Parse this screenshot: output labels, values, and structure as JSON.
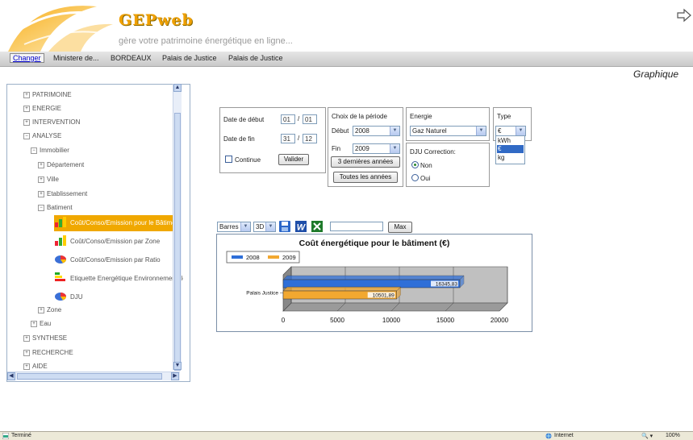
{
  "header": {
    "brand": "GEPweb",
    "tagline": "gère votre patrimoine énergétique en ligne..."
  },
  "nav": {
    "change": "Changer",
    "items": [
      "Ministere de...",
      "BORDEAUX",
      "Palais de Justice",
      "Palais de Justice"
    ]
  },
  "page_title": "Graphique",
  "sidebar": {
    "items": [
      {
        "label": "PATRIMOINE",
        "expand": "+"
      },
      {
        "label": "ENERGIE",
        "expand": "+"
      },
      {
        "label": "INTERVENTION",
        "expand": "+"
      },
      {
        "label": "ANALYSE",
        "expand": "−"
      },
      {
        "label": "Immobilier",
        "expand": "−"
      },
      {
        "label": "Département",
        "expand": "+"
      },
      {
        "label": "Ville",
        "expand": "+"
      },
      {
        "label": "Etablissement",
        "expand": "+"
      },
      {
        "label": "Batiment",
        "expand": "−"
      },
      {
        "label": "Coût/Conso/Emission pour le Bâtiment"
      },
      {
        "label": "Coût/Conso/Emission par Zone"
      },
      {
        "label": "Coût/Conso/Emission par Ratio"
      },
      {
        "label": "Etiquette Energétique Environnementale"
      },
      {
        "label": "DJU"
      },
      {
        "label": "Zone",
        "expand": "+"
      },
      {
        "label": "Eau",
        "expand": "+"
      },
      {
        "label": "SYNTHESE",
        "expand": "+"
      },
      {
        "label": "RECHERCHE",
        "expand": "+"
      },
      {
        "label": "AIDE",
        "expand": "+"
      }
    ]
  },
  "dates": {
    "start_label": "Date de début",
    "start_day": "01",
    "start_month": "01",
    "end_label": "Date de fin",
    "end_day": "31",
    "end_month": "12",
    "sep": "/",
    "continue_label": "Continue",
    "validate": "Valider"
  },
  "period": {
    "title": "Choix de la période",
    "start_label": "Début",
    "start_value": "2008",
    "end_label": "Fin",
    "end_value": "2009",
    "last3": "3 dernières années",
    "all": "Toutes les années"
  },
  "energy": {
    "title": "Energie",
    "value": "Gaz Naturel"
  },
  "dju": {
    "title": "DJU Correction:",
    "no": "Non",
    "yes": "Oui",
    "selected": "Non"
  },
  "type": {
    "title": "Type",
    "value": "€",
    "options": [
      "kWh",
      "€",
      "kg"
    ],
    "selected_option": "€"
  },
  "toolbar": {
    "chart_type": "Barres",
    "dim": "3D",
    "max_button": "Max",
    "icons": [
      "save-icon",
      "word-export-icon",
      "excel-export-icon"
    ]
  },
  "colors": {
    "accent": "#f0a800",
    "series_2008": "#2f6fd8",
    "series_2009": "#f2a830"
  },
  "chart_data": {
    "type": "bar",
    "orientation": "horizontal",
    "title": "Coût énergétique pour le bâtiment (€)",
    "categories": [
      "Palais Justice"
    ],
    "series": [
      {
        "name": "2008",
        "values": [
          16345.83
        ],
        "label": "16345,83"
      },
      {
        "name": "2009",
        "values": [
          10501.89
        ],
        "label": "10501,89"
      }
    ],
    "xlim": [
      0,
      20000
    ],
    "x_ticks": [
      "0",
      "5000",
      "10000",
      "15000",
      "20000"
    ],
    "legend": "top-left",
    "grid": true
  },
  "status": {
    "left": "Terminé",
    "zone": "Internet",
    "zoom": "100%"
  }
}
